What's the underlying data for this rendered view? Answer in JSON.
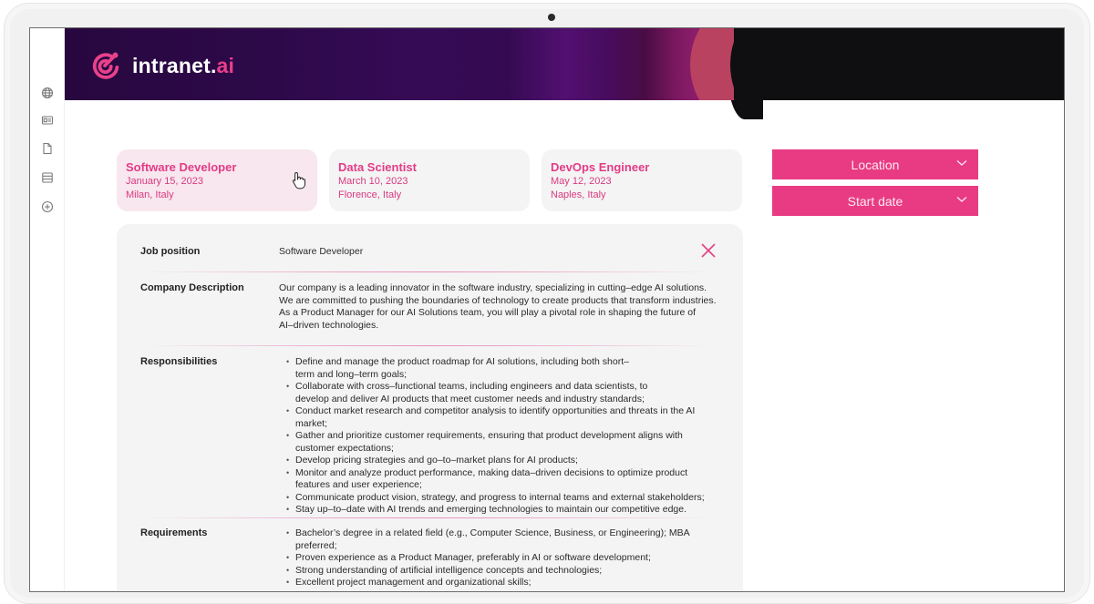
{
  "app": {
    "logo_text": "intranet.",
    "logo_accent": "ai",
    "brand_color": "#e83b84"
  },
  "sidebar": {
    "items": [
      {
        "icon": "globe-icon"
      },
      {
        "icon": "id-card-icon"
      },
      {
        "icon": "document-icon"
      },
      {
        "icon": "table-icon"
      },
      {
        "icon": "add-circle-icon"
      }
    ]
  },
  "job_cards": [
    {
      "title": "Software Developer",
      "date": "January 15, 2023",
      "location": "Milan, Italy",
      "selected": true
    },
    {
      "title": "Data Scientist",
      "date": "March 10, 2023",
      "location": "Florence, Italy",
      "selected": false
    },
    {
      "title": "DevOps Engineer",
      "date": "May 12, 2023",
      "location": "Naples, Italy",
      "selected": false
    }
  ],
  "filters": {
    "location_label": "Location",
    "start_date_label": "Start date"
  },
  "detail": {
    "job_position_label": "Job position",
    "job_position_value": "Software Developer",
    "company_description_label": "Company Description",
    "company_description_lines": [
      "Our company is a leading innovator in the software industry, specializing in cutting–edge AI solutions.",
      "We are committed to pushing the boundaries of technology to create products that transform industries.",
      "As a Product Manager for our AI Solutions team, you will play a pivotal role in shaping the future of",
      "AI–driven technologies."
    ],
    "responsibilities_label": "Responsibilities",
    "responsibilities": [
      "Define and manage the product roadmap for AI solutions, including both short–term and long–term goals;",
      "Collaborate with cross–functional teams, including engineers and data scientists, to develop and deliver AI products that meet customer needs and industry standards;",
      "Conduct market research and competitor analysis to identify opportunities and threats in the AI market;",
      "Gather and prioritize customer requirements, ensuring that product development aligns with customer expectations;",
      "Develop pricing strategies and go–to–market plans for AI products;",
      "Monitor and analyze product performance, making data–driven decisions to optimize product features and user experience;",
      "Communicate product vision, strategy, and progress to internal teams and external stakeholders;",
      "Stay up–to–date with AI trends and emerging technologies to maintain our competitive edge."
    ],
    "requirements_label": "Requirements",
    "requirements": [
      "Bachelor’s degree in a related field (e.g., Computer Science, Business, or Engineering); MBA preferred;",
      "Proven experience as a Product Manager, preferably in AI or software development;",
      "Strong understanding of artificial intelligence concepts and technologies;",
      "Excellent project management and organizational skills;"
    ]
  }
}
